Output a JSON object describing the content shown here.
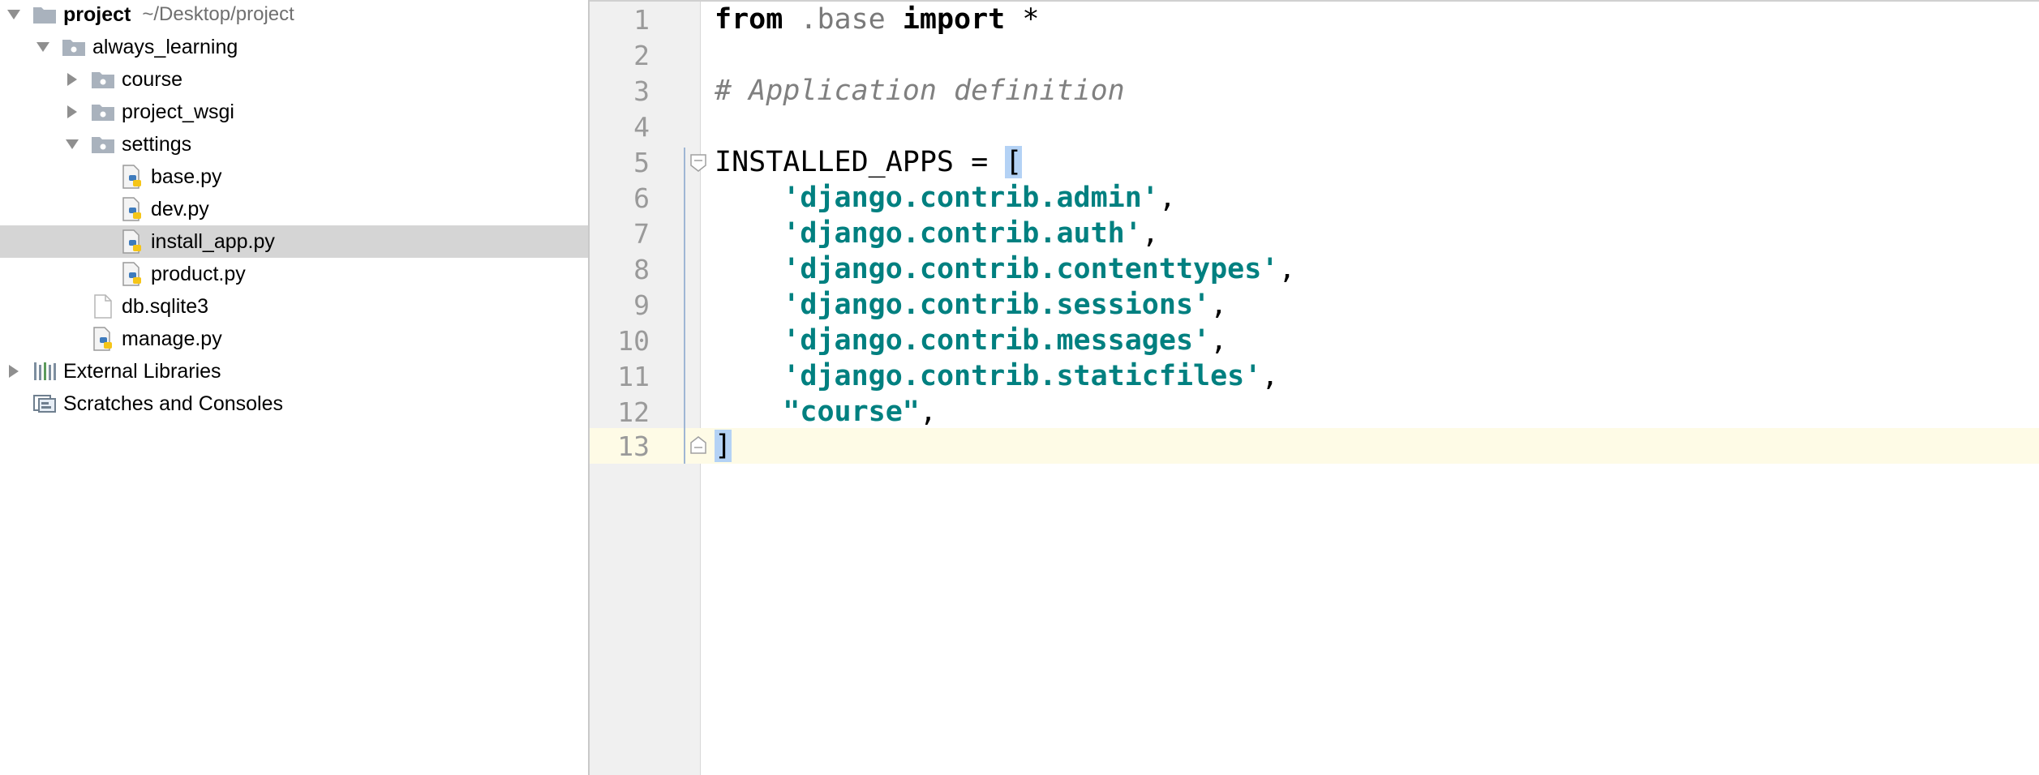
{
  "project_tree": {
    "root": {
      "label": "project",
      "path": "~/Desktop/project"
    },
    "items": [
      {
        "label": "always_learning"
      },
      {
        "label": "course"
      },
      {
        "label": "project_wsgi"
      },
      {
        "label": "settings"
      },
      {
        "label": "base.py"
      },
      {
        "label": "dev.py"
      },
      {
        "label": "install_app.py"
      },
      {
        "label": "product.py"
      },
      {
        "label": "db.sqlite3"
      },
      {
        "label": "manage.py"
      },
      {
        "label": "External Libraries"
      },
      {
        "label": "Scratches and Consoles"
      }
    ],
    "selected_item": "install_app.py"
  },
  "editor": {
    "current_line": 13,
    "line_numbers": [
      "1",
      "2",
      "3",
      "4",
      "5",
      "6",
      "7",
      "8",
      "9",
      "10",
      "11",
      "12",
      "13"
    ],
    "tokens": {
      "l1_from": "from",
      "l1_module": " .base ",
      "l1_import": "import",
      "l1_star": " *",
      "l3_comment": "# Application definition",
      "l5_var": "INSTALLED_APPS = ",
      "l5_open": "[",
      "l6_str": "'django.contrib.admin'",
      "l7_str": "'django.contrib.auth'",
      "l8_str": "'django.contrib.contenttypes'",
      "l9_str": "'django.contrib.sessions'",
      "l10_str": "'django.contrib.messages'",
      "l11_str": "'django.contrib.staticfiles'",
      "l12_str": "\"course\"",
      "comma": ",",
      "indent": "    ",
      "l13_close": "]"
    }
  },
  "colors": {
    "selection_bg": "#d5d5d5",
    "current_line_bg": "#fefbe6",
    "string": "#008080",
    "comment": "#808080",
    "bracket_match_bg": "#b4d2f5",
    "gutter_bg": "#f0f0f0"
  },
  "icons": {
    "expanded": "triangle-down-icon",
    "collapsed": "triangle-right-icon",
    "folder": "folder-icon",
    "python_file": "python-file-icon",
    "generic_file": "file-icon",
    "libraries": "libraries-icon",
    "scratches": "scratches-icon"
  }
}
